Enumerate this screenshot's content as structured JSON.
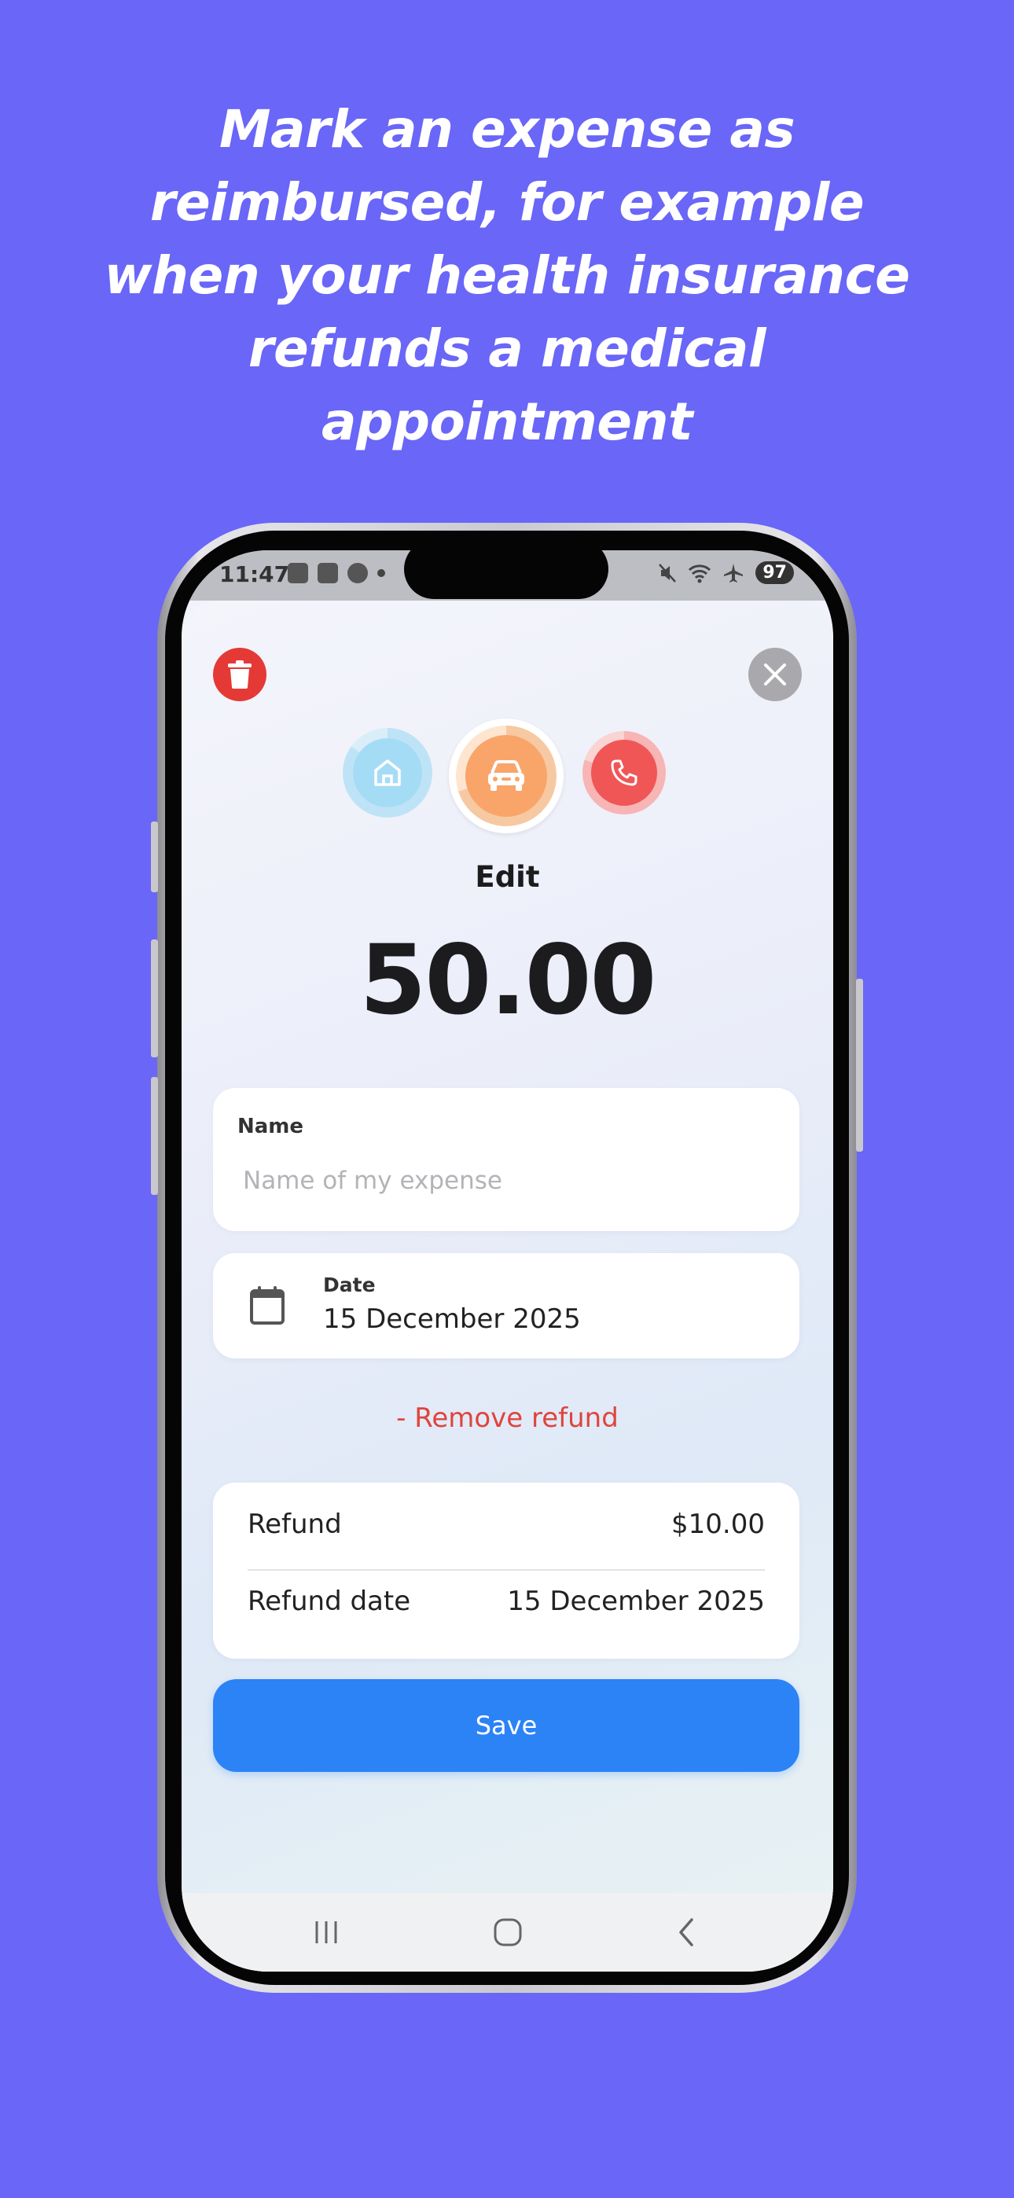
{
  "promo": {
    "headline": "Mark an expense as reimbursed, for example when your health insurance refunds a medical appointment"
  },
  "status_bar": {
    "time": "11:47",
    "battery": "97"
  },
  "sheet": {
    "delete_icon": "trash-icon",
    "close_icon": "close-icon",
    "categories": [
      {
        "name": "home",
        "icon": "home-icon",
        "color": "#A5DCF5"
      },
      {
        "name": "car",
        "icon": "car-icon",
        "color": "#F9A56A",
        "selected": true
      },
      {
        "name": "phone",
        "icon": "phone-icon",
        "color": "#F05656"
      }
    ],
    "title": "Edit",
    "amount": "50.00",
    "name_field": {
      "label": "Name",
      "value": "",
      "placeholder": "Name of my expense"
    },
    "date_field": {
      "label": "Date",
      "value": "15 December 2025"
    },
    "remove_refund_label": "- Remove refund",
    "refund": {
      "refund_label": "Refund",
      "refund_value": "$10.00",
      "refund_date_label": "Refund date",
      "refund_date_value": "15 December 2025"
    },
    "save_label": "Save"
  },
  "colors": {
    "background": "#6966F8",
    "primary": "#2B83F6",
    "danger": "#E53935"
  }
}
